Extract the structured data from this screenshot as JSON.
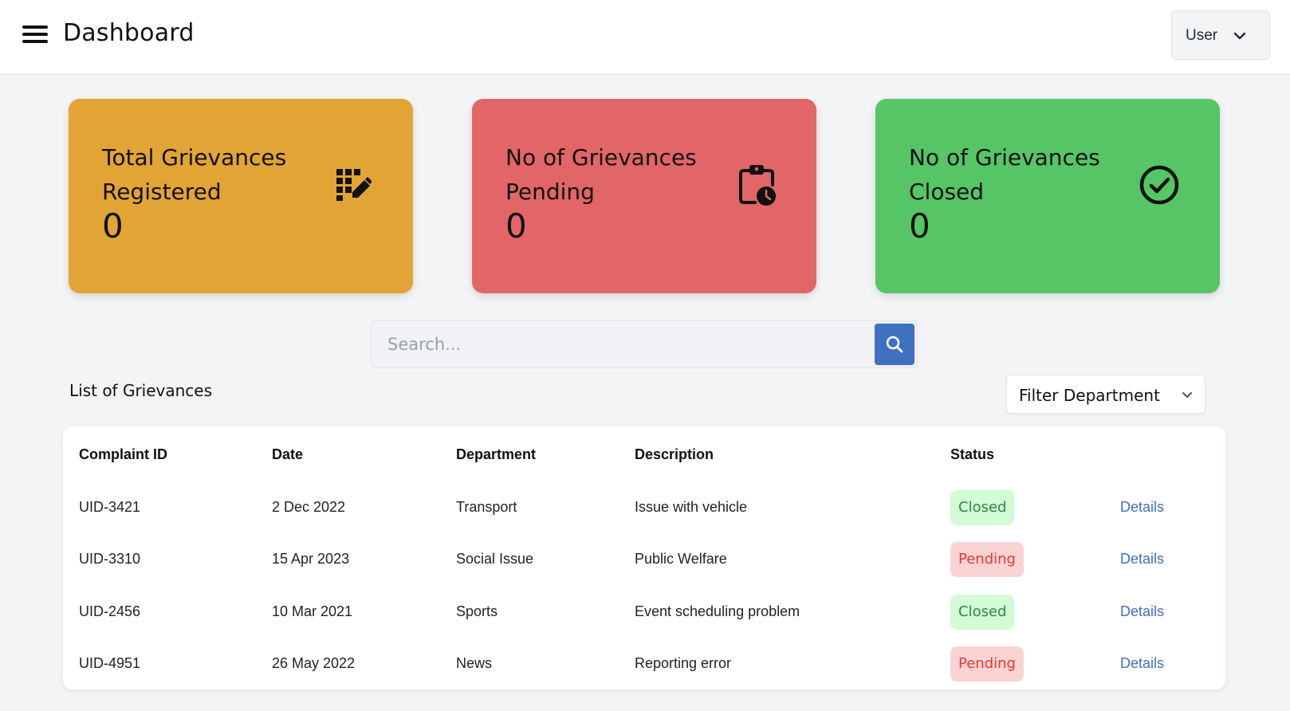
{
  "header": {
    "title": "Dashboard",
    "user_label": "User",
    "menu_icon": "menu-icon",
    "user_chevron_icon": "chevron-down-icon"
  },
  "cards": [
    {
      "title": "Total Grievances Registered",
      "count": "0",
      "color": "#e2a434",
      "icon": "edit-grid-icon"
    },
    {
      "title": "No of Grievances Pending",
      "count": "0",
      "color": "#e26667",
      "icon": "clipboard-clock-icon"
    },
    {
      "title": "No of Grievances Closed",
      "count": "0",
      "color": "#56c565",
      "icon": "check-circle-icon"
    }
  ],
  "search": {
    "placeholder": "Search...",
    "value": "",
    "button_icon": "search-icon",
    "button_color": "#3f6fbf"
  },
  "list": {
    "title": "List of Grievances",
    "filter_label": "Filter Department",
    "filter_icon": "chevron-down-icon"
  },
  "table": {
    "headers": [
      "Complaint ID",
      "Date",
      "Department",
      "Description",
      "Status"
    ],
    "rows": [
      {
        "id": "UID-3421",
        "date": "2 Dec 2022",
        "department": "Transport",
        "description": "Issue with vehicle",
        "status": "Closed",
        "action": "Details"
      },
      {
        "id": "UID-3310",
        "date": "15 Apr 2023",
        "department": "Social Issue",
        "description": "Public Welfare",
        "status": "Pending",
        "action": "Details"
      },
      {
        "id": "UID-2456",
        "date": "10 Mar 2021",
        "department": "Sports",
        "description": "Event scheduling problem",
        "status": "Closed",
        "action": "Details"
      },
      {
        "id": "UID-4951",
        "date": "26 May 2022",
        "department": "News",
        "description": "Reporting error",
        "status": "Pending",
        "action": "Details"
      }
    ]
  },
  "colors": {
    "closed_bg": "#d2fbd6",
    "closed_text": "#2d8a3a",
    "pending_bg": "#fbd3d3",
    "pending_text": "#e53935",
    "link": "#3f6fbf"
  }
}
